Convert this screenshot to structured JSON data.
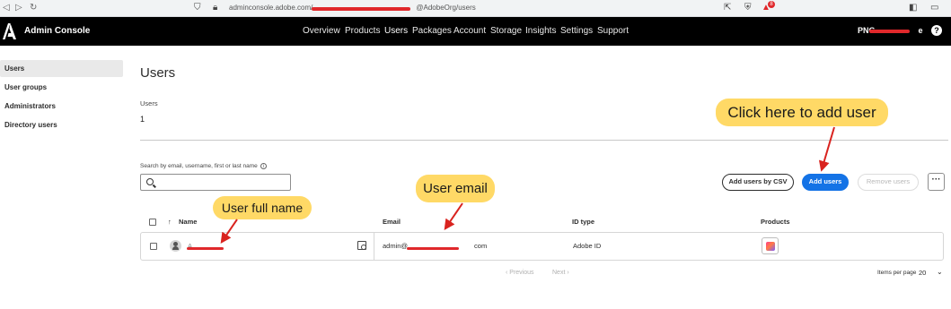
{
  "browser": {
    "url_visible_start": "adminconsole.adobe.com/",
    "url_visible_end": "@AdobeOrg/users",
    "notification_count": "8"
  },
  "topnav": {
    "app_title": "Admin Console",
    "items": [
      "Overview",
      "Products",
      "Users",
      "Packages",
      "Account",
      "Storage",
      "Insights",
      "Settings",
      "Support"
    ],
    "active_item": "Users",
    "org_prefix": "PNG",
    "org_suffix": "e",
    "help_label": "?"
  },
  "sidebar": {
    "items": [
      "Users",
      "User groups",
      "Administrators",
      "Directory users"
    ],
    "active_item": "Users"
  },
  "main": {
    "page_title": "Users",
    "count_label": "Users",
    "count_value": "1",
    "search_label": "Search by email, username, first or last name",
    "search_placeholder": "",
    "buttons": {
      "add_csv": "Add users by CSV",
      "add_users": "Add users",
      "remove_users": "Remove users",
      "more": "···"
    },
    "table": {
      "columns": [
        "Name",
        "Email",
        "ID type",
        "Products"
      ],
      "sort_indicator": "↑",
      "rows": [
        {
          "name": "A",
          "email_prefix": "admin@",
          "email_suffix": "com",
          "id_type": "Adobe ID"
        }
      ]
    },
    "pagination": {
      "previous": "‹ Previous",
      "next": "Next ›",
      "items_per_page_label": "Items per page",
      "items_per_page_value": "20"
    }
  },
  "annotations": {
    "add_user": "Click here to add user",
    "full_name": "User full name",
    "email": "User email",
    "callout_color": "#ffd966",
    "arrow_color": "#d9231f"
  },
  "colors": {
    "primary_blue": "#1473e6",
    "nav_black": "#000000",
    "redaction_red": "#e0282b"
  }
}
